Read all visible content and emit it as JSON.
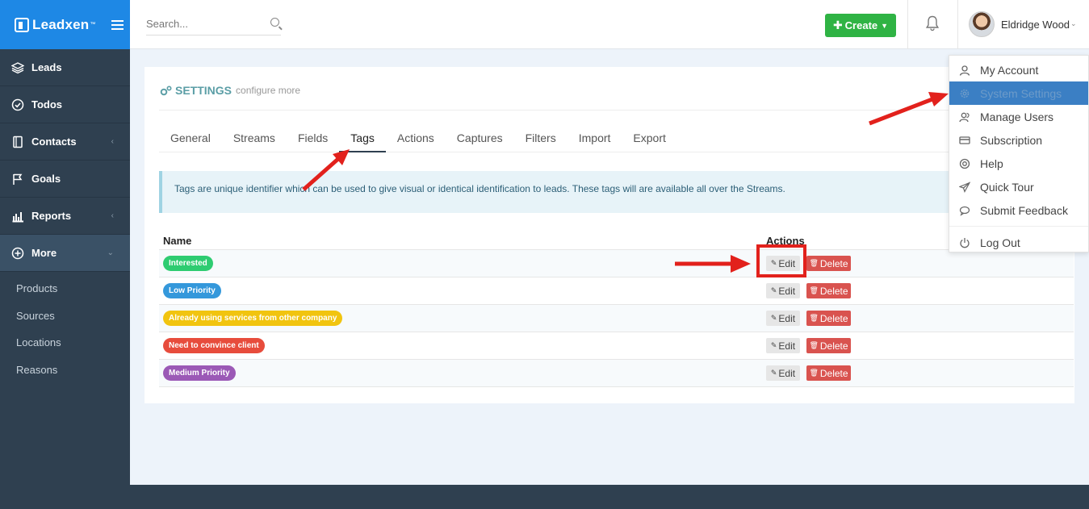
{
  "brand": {
    "name": "Leadxen",
    "tm": "™"
  },
  "header": {
    "search_placeholder": "Search...",
    "create_label": "Create",
    "user_name": "Eldridge Wood"
  },
  "sidebar": {
    "items": [
      {
        "label": "Leads",
        "icon": "layers-icon",
        "arrow": ""
      },
      {
        "label": "Todos",
        "icon": "check-circle-icon",
        "arrow": ""
      },
      {
        "label": "Contacts",
        "icon": "address-book-icon",
        "arrow": "‹"
      },
      {
        "label": "Goals",
        "icon": "flag-icon",
        "arrow": ""
      },
      {
        "label": "Reports",
        "icon": "bar-chart-icon",
        "arrow": "‹"
      },
      {
        "label": "More",
        "icon": "plus-circle-icon",
        "arrow": "⌄"
      }
    ],
    "sub_items": [
      "Products",
      "Sources",
      "Locations",
      "Reasons"
    ]
  },
  "settings": {
    "title": "SETTINGS",
    "subtitle": "configure more",
    "tabs": [
      "General",
      "Streams",
      "Fields",
      "Tags",
      "Actions",
      "Captures",
      "Filters",
      "Import",
      "Export"
    ],
    "active_tab": "Tags",
    "notice": "Tags are unique identifier which can be used to give visual or identical identification to leads. These tags will are available all over the Streams."
  },
  "table": {
    "headers": {
      "name": "Name",
      "actions": "Actions"
    },
    "edit_label": "Edit",
    "delete_label": "Delete",
    "rows": [
      {
        "tag": "Interested",
        "color": "#2ecc71"
      },
      {
        "tag": "Low Priority",
        "color": "#3498db"
      },
      {
        "tag": "Already using services from other company",
        "color": "#f1c40f"
      },
      {
        "tag": "Need to convince client",
        "color": "#e74c3c"
      },
      {
        "tag": "Medium Priority",
        "color": "#9b59b6"
      }
    ]
  },
  "user_menu": {
    "items": [
      {
        "label": "My Account",
        "icon": "user-icon"
      },
      {
        "label": "System Settings",
        "icon": "gear-icon",
        "active": true
      },
      {
        "label": "Manage Users",
        "icon": "users-icon"
      },
      {
        "label": "Subscription",
        "icon": "credit-card-icon"
      },
      {
        "label": "Help",
        "icon": "lifebuoy-icon"
      },
      {
        "label": "Quick Tour",
        "icon": "paper-plane-icon"
      },
      {
        "label": "Submit Feedback",
        "icon": "chat-bubble-icon"
      }
    ],
    "logout_label": "Log Out"
  },
  "colors": {
    "brand_blue": "#1e88e5",
    "sidebar": "#2f4050",
    "create_green": "#2fb344",
    "delete_red": "#d9534f",
    "annotation_red": "#e2211c"
  }
}
